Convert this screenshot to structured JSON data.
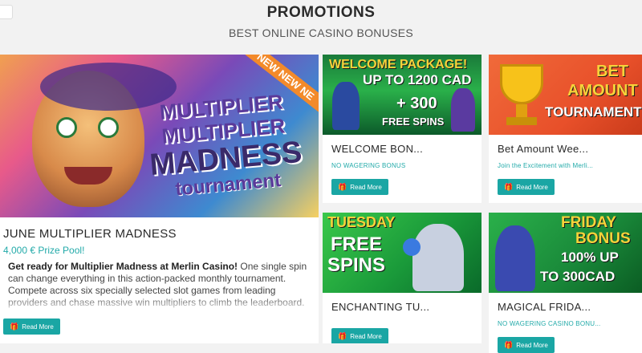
{
  "header": {
    "title": "PROMOTIONS",
    "subtitle": "BEST ONLINE CASINO BONUSES"
  },
  "featured": {
    "ribbon": "NEW NEW NE",
    "art_lines": [
      "MULTIPLIER",
      "MULTIPLIER",
      "MADNESS",
      "tournament"
    ],
    "title": "JUNE MULTIPLIER MADNESS",
    "subtitle": "4,000 € Prize Pool!",
    "desc_bold": "Get ready for Multiplier Madness at Merlin Casino!",
    "desc_rest": " One single spin can change everything in this action-packed monthly tournament. Compete across six specially selected slot games from leading providers and chase massive win multipliers to climb the leaderboard. Land that huge multiplier and secure your place at the top!",
    "button": "Read More"
  },
  "cards": [
    {
      "banner_line1": "WELCOME PACKAGE!",
      "banner_line2": "UP TO 1200 CAD",
      "banner_line3": "+ 300",
      "banner_line4": "FREE SPINS",
      "title": "WELCOME BON...",
      "subtitle": "NO WAGERING BONUS",
      "button": "Read More"
    },
    {
      "banner_line1": "BET",
      "banner_line2": "AMOUNT",
      "banner_line3": "TOURNAMENT",
      "title": "Bet Amount Wee...",
      "subtitle": "Join the Excitement with Merli...",
      "button": "Read More"
    },
    {
      "banner_line1": "TUESDAY",
      "banner_line2": "FREE",
      "banner_line3": "SPINS",
      "title": "ENCHANTING TU...",
      "subtitle": "",
      "button": "Read More"
    },
    {
      "banner_line1": "FRIDAY",
      "banner_line2": "BONUS",
      "banner_line3": "100% UP",
      "banner_line4": "TO 300CAD",
      "title": "MAGICAL FRIDA...",
      "subtitle": "NO WAGERING CASINO BONU...",
      "button": "Read More"
    }
  ],
  "colors": {
    "accent": "#1aa6a4",
    "subtitle_teal": "#22aaa9",
    "page_bg": "#f2f2f2"
  },
  "icons": {
    "button_icon": "gift-icon"
  }
}
